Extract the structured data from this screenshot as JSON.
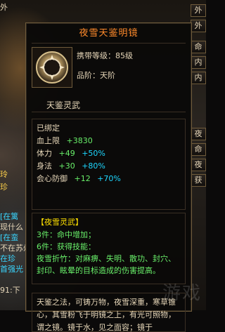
{
  "left_sidebar": {
    "items": [
      {
        "text": "外",
        "class": ""
      },
      {
        "text": "玲",
        "class": "yellow"
      },
      {
        "text": "珍",
        "class": "yellow"
      },
      {
        "text": "[在篱",
        "class": "cyan"
      },
      {
        "text": "现什么",
        "class": ""
      },
      {
        "text": "[在蛮",
        "class": "cyan"
      },
      {
        "text": "不在苏州",
        "class": ""
      },
      {
        "text": "在珍",
        "class": "cyan"
      },
      {
        "text": "首强光",
        "class": "cyan"
      },
      {
        "text": "91:下",
        "class": ""
      }
    ]
  },
  "right_tabs": [
    {
      "label": "外"
    },
    {
      "label": "外"
    },
    {
      "label": "命"
    },
    {
      "label": "内"
    },
    {
      "label": "内"
    },
    {
      "label": "夜"
    },
    {
      "label": "命"
    },
    {
      "label": "夜"
    },
    {
      "label": "获"
    }
  ],
  "tooltip": {
    "title": "夜雪天鉴明镜",
    "level_text": "携带等级：85级",
    "rank_text": "品阶：天阶",
    "section_title": "天鉴灵武",
    "bound": "已绑定",
    "stats": [
      {
        "label": "血上限",
        "value": "+3830",
        "percent": ""
      },
      {
        "label": "体力",
        "value": "+49",
        "percent": "+50%"
      },
      {
        "label": "身法",
        "value": "+30",
        "percent": "+80%"
      },
      {
        "label": "会心防御",
        "value": "+12",
        "percent": "+70%"
      }
    ],
    "set": {
      "title": "【夜雪灵武】",
      "lines": [
        "3件：命中增加；",
        "6件：获得技能：",
        "夜雪折竹：对麻痹、失明、散功、封穴、封印、眩晕的目标造成的伤害提高。"
      ]
    },
    "description": "天鉴之法，可铸万物，夜雪深重，寒草锥心，其雪粉飞于明镜之上，有光可照物，谓之镜。镜于水，见之面容；镜于"
  },
  "watermark": "游戏"
}
